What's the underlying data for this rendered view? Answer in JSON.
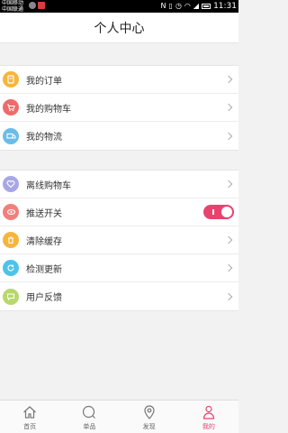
{
  "status": {
    "carrier1": "中国移动",
    "carrier2": "中国联通",
    "time": "11:31"
  },
  "header": {
    "title": "个人中心"
  },
  "groups": [
    {
      "items": [
        {
          "label": "我的订单",
          "icon": "order-icon",
          "color": "#f6b53b"
        },
        {
          "label": "我的购物车",
          "icon": "cart-icon",
          "color": "#ef6a6a"
        },
        {
          "label": "我的物流",
          "icon": "truck-icon",
          "color": "#6bbde8"
        }
      ]
    },
    {
      "items": [
        {
          "label": "离线购物车",
          "icon": "heart-icon",
          "color": "#a9a6e8"
        },
        {
          "label": "推送开关",
          "icon": "eye-icon",
          "color": "#f0807c",
          "toggle": true,
          "toggle_on": true
        },
        {
          "label": "清除缓存",
          "icon": "trash-icon",
          "color": "#f6b53b"
        },
        {
          "label": "检测更新",
          "icon": "refresh-icon",
          "color": "#4ec3ea"
        },
        {
          "label": "用户反馈",
          "icon": "chat-icon",
          "color": "#b7d86b"
        }
      ]
    }
  ],
  "tabbar": {
    "active": 3,
    "accent": "#e8436f",
    "items": [
      {
        "label": "首页",
        "icon": "home-icon"
      },
      {
        "label": "单品",
        "icon": "search-icon"
      },
      {
        "label": "发现",
        "icon": "location-icon"
      },
      {
        "label": "我的",
        "icon": "user-icon"
      }
    ]
  }
}
